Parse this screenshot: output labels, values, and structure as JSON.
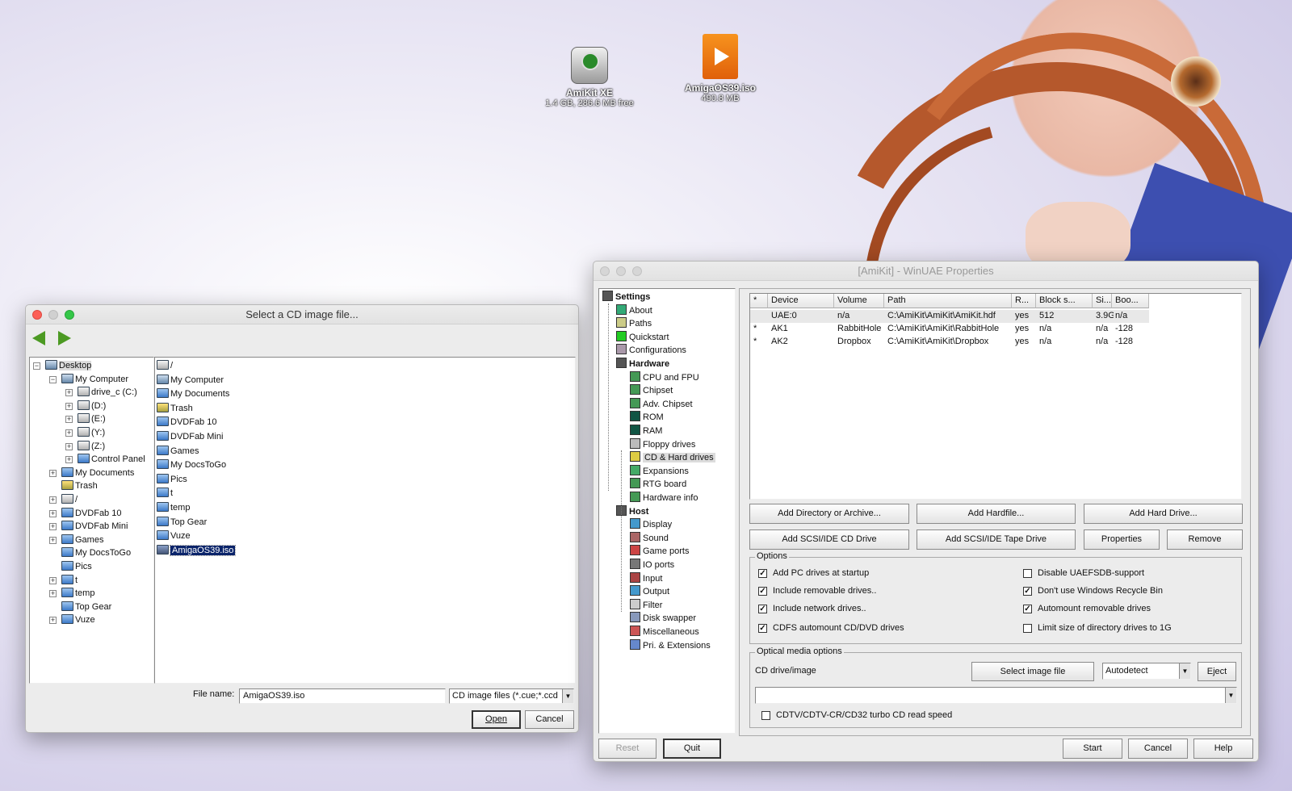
{
  "desktop": {
    "icons": [
      {
        "name": "AmiKit XE",
        "sub": "1.4 GB, 286.6 MB free",
        "icon": "hard-drive-icon"
      },
      {
        "name": "AmigaOS39.iso",
        "sub": "490.8 MB",
        "icon": "media-file-icon"
      }
    ]
  },
  "filedialog": {
    "title": "Select a CD image file...",
    "tree": [
      {
        "label": "Desktop",
        "icon": "desktop",
        "depth": 0,
        "exp": "−"
      },
      {
        "label": "My Computer",
        "icon": "comp",
        "depth": 1,
        "exp": "−"
      },
      {
        "label": "drive_c (C:)",
        "icon": "drive",
        "depth": 2,
        "exp": "+"
      },
      {
        "label": "(D:)",
        "icon": "drive",
        "depth": 2,
        "exp": "+"
      },
      {
        "label": "(E:)",
        "icon": "drive",
        "depth": 2,
        "exp": "+"
      },
      {
        "label": "(Y:)",
        "icon": "drive",
        "depth": 2,
        "exp": "+"
      },
      {
        "label": "(Z:)",
        "icon": "drive",
        "depth": 2,
        "exp": "+"
      },
      {
        "label": "Control Panel",
        "icon": "folder",
        "depth": 2,
        "exp": "+"
      },
      {
        "label": "My Documents",
        "icon": "folder",
        "depth": 1,
        "exp": "+"
      },
      {
        "label": "Trash",
        "icon": "trash",
        "depth": 1,
        "exp": ""
      },
      {
        "label": "/",
        "icon": "drive",
        "depth": 1,
        "exp": "+"
      },
      {
        "label": "DVDFab 10",
        "icon": "folder",
        "depth": 1,
        "exp": "+"
      },
      {
        "label": "DVDFab Mini",
        "icon": "folder",
        "depth": 1,
        "exp": "+"
      },
      {
        "label": "Games",
        "icon": "folder",
        "depth": 1,
        "exp": "+"
      },
      {
        "label": "My DocsToGo",
        "icon": "folder",
        "depth": 1,
        "exp": ""
      },
      {
        "label": "Pics",
        "icon": "folder",
        "depth": 1,
        "exp": ""
      },
      {
        "label": "t",
        "icon": "folder",
        "depth": 1,
        "exp": "+"
      },
      {
        "label": "temp",
        "icon": "folder",
        "depth": 1,
        "exp": "+"
      },
      {
        "label": "Top Gear",
        "icon": "folder",
        "depth": 1,
        "exp": ""
      },
      {
        "label": "Vuze",
        "icon": "folder",
        "depth": 1,
        "exp": "+"
      }
    ],
    "files": [
      {
        "label": "/",
        "icon": "drive"
      },
      {
        "label": "My Computer",
        "icon": "comp"
      },
      {
        "label": "My Documents",
        "icon": "folder"
      },
      {
        "label": "Trash",
        "icon": "trash"
      },
      {
        "label": "DVDFab 10",
        "icon": "folder"
      },
      {
        "label": "DVDFab Mini",
        "icon": "folder"
      },
      {
        "label": "Games",
        "icon": "folder"
      },
      {
        "label": "My DocsToGo",
        "icon": "folder"
      },
      {
        "label": "Pics",
        "icon": "folder"
      },
      {
        "label": "t",
        "icon": "folder"
      },
      {
        "label": "temp",
        "icon": "folder"
      },
      {
        "label": "Top Gear",
        "icon": "folder"
      },
      {
        "label": "Vuze",
        "icon": "folder"
      },
      {
        "label": "AmigaOS39.iso",
        "icon": "iso",
        "selected": true
      }
    ],
    "filename_label": "File name:",
    "filename_value": "AmigaOS39.iso",
    "filter_value": "CD image files (*.cue;*.ccd",
    "open_label": "Open",
    "cancel_label": "Cancel"
  },
  "winuae": {
    "title": "[AmiKit] - WinUAE Properties",
    "settings_tree": [
      {
        "label": "Settings",
        "bold": true,
        "depth": 0
      },
      {
        "label": "About",
        "depth": 1
      },
      {
        "label": "Paths",
        "depth": 1
      },
      {
        "label": "Quickstart",
        "depth": 1
      },
      {
        "label": "Configurations",
        "depth": 1
      },
      {
        "label": "Hardware",
        "bold": true,
        "depth": 1
      },
      {
        "label": "CPU and FPU",
        "depth": 2
      },
      {
        "label": "Chipset",
        "depth": 2
      },
      {
        "label": "Adv. Chipset",
        "depth": 2
      },
      {
        "label": "ROM",
        "depth": 2
      },
      {
        "label": "RAM",
        "depth": 2
      },
      {
        "label": "Floppy drives",
        "depth": 2
      },
      {
        "label": "CD & Hard drives",
        "depth": 2,
        "selected": true
      },
      {
        "label": "Expansions",
        "depth": 2
      },
      {
        "label": "RTG board",
        "depth": 2
      },
      {
        "label": "Hardware info",
        "depth": 2
      },
      {
        "label": "Host",
        "bold": true,
        "depth": 1
      },
      {
        "label": "Display",
        "depth": 2
      },
      {
        "label": "Sound",
        "depth": 2
      },
      {
        "label": "Game ports",
        "depth": 2
      },
      {
        "label": "IO ports",
        "depth": 2
      },
      {
        "label": "Input",
        "depth": 2
      },
      {
        "label": "Output",
        "depth": 2
      },
      {
        "label": "Filter",
        "depth": 2
      },
      {
        "label": "Disk swapper",
        "depth": 2
      },
      {
        "label": "Miscellaneous",
        "depth": 2
      },
      {
        "label": "Pri. & Extensions",
        "depth": 2
      }
    ],
    "table": {
      "columns": [
        "*",
        "Device",
        "Volume",
        "Path",
        "R...",
        "Block s...",
        "Si...",
        "Boo..."
      ],
      "rows": [
        [
          "",
          "UAE:0",
          "n/a",
          "C:\\AmiKit\\AmiKit\\AmiKit.hdf",
          "yes",
          "512",
          "3.9G",
          "n/a"
        ],
        [
          "*",
          "AK1",
          "RabbitHole",
          "C:\\AmiKit\\AmiKit\\RabbitHole",
          "yes",
          "n/a",
          "n/a",
          "-128"
        ],
        [
          "*",
          "AK2",
          "Dropbox",
          "C:\\AmiKit\\AmiKit\\Dropbox",
          "yes",
          "n/a",
          "n/a",
          "-128"
        ]
      ]
    },
    "buttons": {
      "add_dir": "Add Directory or Archive...",
      "add_hardfile": "Add Hardfile...",
      "add_hard_drive": "Add Hard Drive...",
      "add_cd": "Add SCSI/IDE CD Drive",
      "add_tape": "Add SCSI/IDE Tape Drive",
      "properties": "Properties",
      "remove": "Remove"
    },
    "options_title": "Options",
    "options_left": [
      {
        "label": "Add PC drives at startup",
        "checked": true
      },
      {
        "label": "Include removable drives..",
        "checked": true
      },
      {
        "label": "Include network drives..",
        "checked": true
      },
      {
        "label": "CDFS automount CD/DVD drives",
        "checked": true
      }
    ],
    "options_right": [
      {
        "label": "Disable UAEFSDB-support",
        "checked": false
      },
      {
        "label": "Don't use Windows Recycle Bin",
        "checked": true
      },
      {
        "label": "Automount removable drives",
        "checked": true
      },
      {
        "label": "Limit size of directory drives to 1G",
        "checked": false
      }
    ],
    "optical_title": "Optical media options",
    "cd_label": "CD drive/image",
    "select_image": "Select image file",
    "autodetect": "Autodetect",
    "eject": "Eject",
    "cdtv_label": "CDTV/CDTV-CR/CD32 turbo CD read speed",
    "cdtv_checked": false,
    "bottom": {
      "reset": "Reset",
      "quit": "Quit",
      "start": "Start",
      "cancel": "Cancel",
      "help": "Help"
    }
  }
}
